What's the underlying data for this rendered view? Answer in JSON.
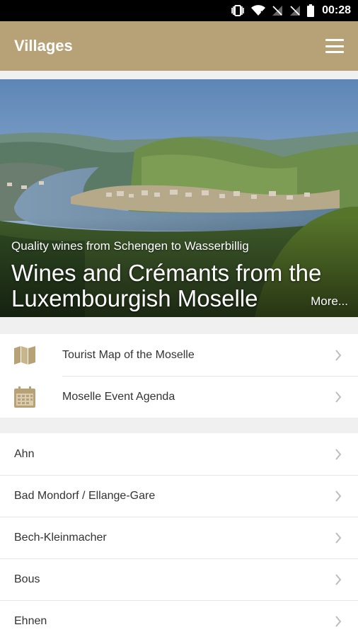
{
  "status_bar": {
    "time": "00:28",
    "icons": [
      "vibrate-icon",
      "wifi-icon",
      "no-signal-icon",
      "no-signal-icon",
      "battery-icon"
    ]
  },
  "app_bar": {
    "title": "Villages",
    "menu_icon": "hamburger-menu-icon"
  },
  "hero": {
    "subtitle": "Quality wines from Schengen to Wasserbillig",
    "title": "Wines and Crémants from the Luxembourgish Moselle",
    "more_label": "More..."
  },
  "quick_links": [
    {
      "label": "Tourist Map of the Moselle",
      "icon": "map-icon"
    },
    {
      "label": "Moselle Event Agenda",
      "icon": "calendar-icon"
    }
  ],
  "villages": [
    {
      "label": "Ahn"
    },
    {
      "label": "Bad Mondorf / Ellange-Gare"
    },
    {
      "label": "Bech-Kleinmacher"
    },
    {
      "label": "Bous"
    },
    {
      "label": "Ehnen"
    }
  ],
  "colors": {
    "accent": "#b7a176",
    "background": "#f0f0f0",
    "text": "#333333",
    "chevron": "#bdbdbd"
  }
}
